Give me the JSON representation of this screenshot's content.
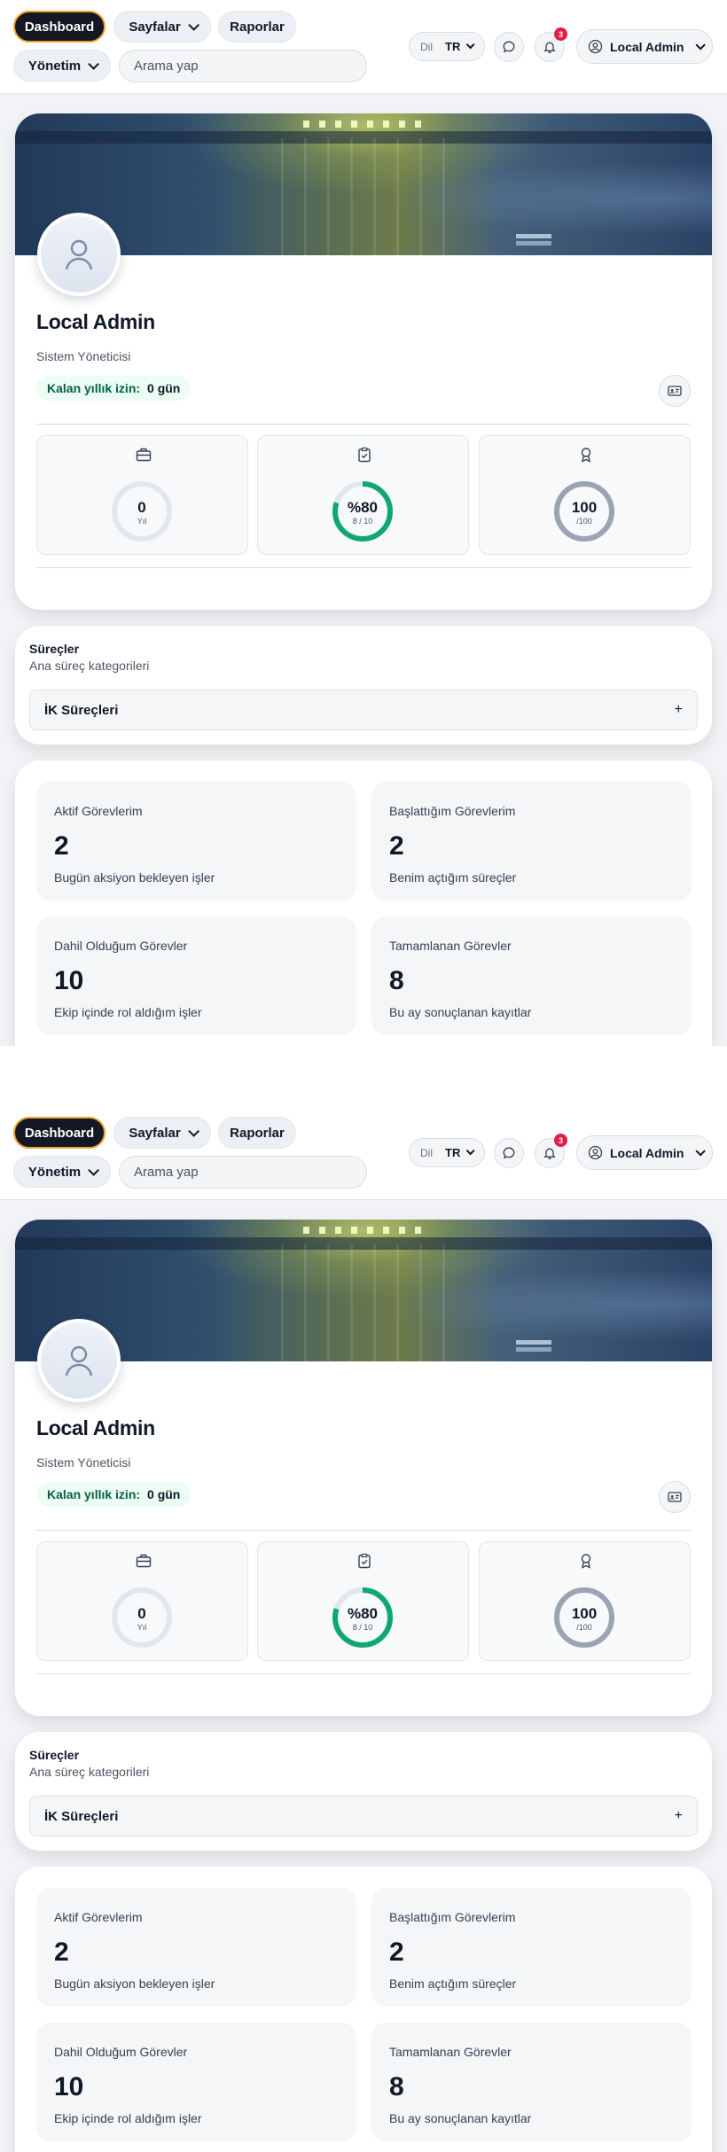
{
  "nav": {
    "dashboard": "Dashboard",
    "pages": "Sayfalar",
    "reports": "Raporlar",
    "management": "Yönetim",
    "search_placeholder": "Arama yap"
  },
  "lang": {
    "label": "Dil",
    "value": "TR"
  },
  "notifications": {
    "count": "3"
  },
  "user": {
    "name": "Local Admin"
  },
  "profile": {
    "name": "Local Admin",
    "role": "Sistem Yöneticisi",
    "leave_label": "Kalan yıllık izin:",
    "leave_value": "0 gün",
    "stats": [
      {
        "icon": "briefcase-icon",
        "value": "0",
        "unit": "Yıl",
        "fraction": 0
      },
      {
        "icon": "clipboard-check-icon",
        "value": "%80",
        "unit": "8 / 10",
        "fraction": 0.8
      },
      {
        "icon": "award-icon",
        "value": "100",
        "unit": "/100",
        "fraction": 1.0
      }
    ]
  },
  "processes": {
    "title": "Süreçler",
    "subtitle": "Ana süreç kategorileri",
    "items": [
      {
        "label": "İK Süreçleri",
        "toggle": "+"
      }
    ]
  },
  "tasks": [
    {
      "label": "Aktif Görevlerim",
      "value": "2",
      "desc": "Bugün aksiyon bekleyen işler"
    },
    {
      "label": "Başlattığım Görevlerim",
      "value": "2",
      "desc": "Benim açtığım süreçler"
    },
    {
      "label": "Dahil Olduğum Görevler",
      "value": "10",
      "desc": "Ekip içinde rol aldığım işler"
    },
    {
      "label": "Tamamlanan Görevler",
      "value": "8",
      "desc": "Bu ay sonuçlanan kayıtlar"
    }
  ],
  "colors": {
    "accent": "#f0a32d",
    "progress": "#10a870",
    "ring_track": "#e2e7ef",
    "full_ring": "#9aa4b2",
    "badge": "#e11d48"
  }
}
